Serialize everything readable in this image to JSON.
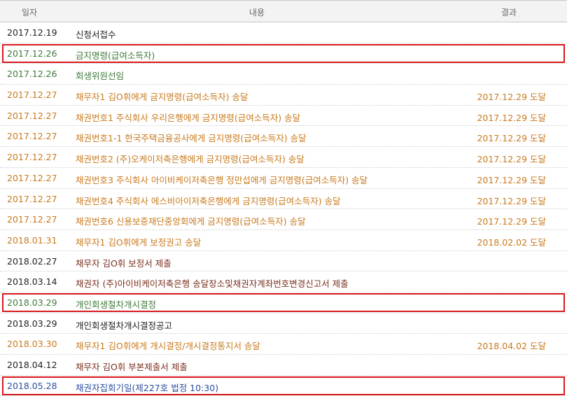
{
  "headers": {
    "date": "일자",
    "content": "내용",
    "result": "결과"
  },
  "colors": {
    "black": "#222222",
    "green": "#3f7a3a",
    "orange": "#c87a1e",
    "brown": "#7a2e1e",
    "blue": "#2c4f9e",
    "highlight": "#d9181c"
  },
  "rows": [
    {
      "date": "2017.12.19",
      "content": "신청서접수",
      "result": "",
      "color": "black",
      "contentColor": "black",
      "highlight": false
    },
    {
      "date": "2017.12.26",
      "content": "금지명령(급여소득자)",
      "result": "",
      "color": "green",
      "contentColor": "green",
      "highlight": true
    },
    {
      "date": "2017.12.26",
      "content": "회생위원선임",
      "result": "",
      "color": "green",
      "contentColor": "green",
      "highlight": false
    },
    {
      "date": "2017.12.27",
      "content": "채무자1 김O휘에게 금지명령(급여소득자) 송달",
      "result": "2017.12.29 도달",
      "color": "orange",
      "contentColor": "orange",
      "highlight": false
    },
    {
      "date": "2017.12.27",
      "content": "채권번호1 주식회사 우리은행에게 금지명령(급여소득자) 송달",
      "result": "2017.12.29 도달",
      "color": "orange",
      "contentColor": "orange",
      "highlight": false
    },
    {
      "date": "2017.12.27",
      "content": "채권번호1-1 한국주택금융공사에게 금지명령(급여소득자) 송달",
      "result": "2017.12.29 도달",
      "color": "orange",
      "contentColor": "orange",
      "highlight": false
    },
    {
      "date": "2017.12.27",
      "content": "채권번호2 (주)오케이저축은행에게 금지명령(급여소득자) 송달",
      "result": "2017.12.29 도달",
      "color": "orange",
      "contentColor": "orange",
      "highlight": false
    },
    {
      "date": "2017.12.27",
      "content": "채권번호3 주식회사 아이비케이저축은행 정만섭에게 금지명령(급여소득자) 송달",
      "result": "2017.12.29 도달",
      "color": "orange",
      "contentColor": "orange",
      "highlight": false
    },
    {
      "date": "2017.12.27",
      "content": "채권번호4 주식회사 에스비아이저축은행에게 금지명령(급여소득자) 송달",
      "result": "2017.12.29 도달",
      "color": "orange",
      "contentColor": "orange",
      "highlight": false
    },
    {
      "date": "2017.12.27",
      "content": "채권번호6 신용보증재단중앙회에게 금지명령(급여소득자) 송달",
      "result": "2017.12.29 도달",
      "color": "orange",
      "contentColor": "orange",
      "highlight": false
    },
    {
      "date": "2018.01.31",
      "content": "채무자1 김O휘에게 보정권고 송달",
      "result": "2018.02.02 도달",
      "color": "orange",
      "contentColor": "orange",
      "highlight": false
    },
    {
      "date": "2018.02.27",
      "content": "채무자 김O휘 보정서 제출",
      "result": "",
      "color": "black",
      "contentColor": "brown",
      "highlight": false
    },
    {
      "date": "2018.03.14",
      "content": "채권자 (주)아이비케이저축은행 송달장소및채권자계좌번호변경신고서 제출",
      "result": "",
      "color": "black",
      "contentColor": "brown",
      "highlight": false
    },
    {
      "date": "2018.03.29",
      "content": "개인회생절차개시결정",
      "result": "",
      "color": "green",
      "contentColor": "green",
      "highlight": true
    },
    {
      "date": "2018.03.29",
      "content": "개인회생절차개시결정공고",
      "result": "",
      "color": "black",
      "contentColor": "black",
      "highlight": false
    },
    {
      "date": "2018.03.30",
      "content": "채무자1 김O휘에게 개시결정/개시결정통지서 송달",
      "result": "2018.04.02 도달",
      "color": "orange",
      "contentColor": "orange",
      "highlight": false
    },
    {
      "date": "2018.04.12",
      "content": "채무자 김O휘 부본제출서 제출",
      "result": "",
      "color": "black",
      "contentColor": "brown",
      "highlight": false
    },
    {
      "date": "2018.05.28",
      "content": "채권자집회기일(제227호 법정 10:30)",
      "result": "",
      "color": "blue",
      "contentColor": "blue",
      "highlight": true
    }
  ]
}
